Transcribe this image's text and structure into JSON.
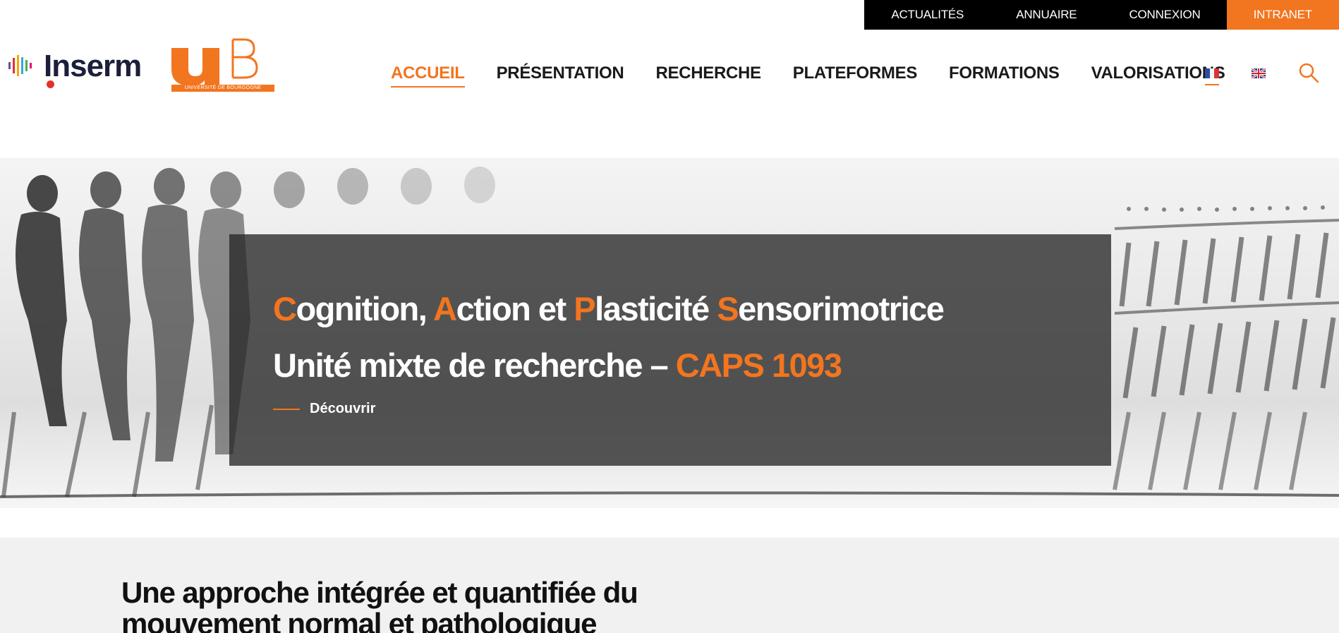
{
  "topbar": {
    "links": [
      "ACTUALITÉS",
      "ANNUAIRE",
      "CONNEXION",
      "INTRANET"
    ],
    "colors": {
      "default_bg": "#000000",
      "highlight_bg": "#f2751f"
    }
  },
  "logos": {
    "inserm": "Inserm",
    "ub_caption": "UNIVERSITÉ DE BOURGOGNE"
  },
  "nav": {
    "items": [
      "ACCUEIL",
      "PRÉSENTATION",
      "RECHERCHE",
      "PLATEFORMES",
      "FORMATIONS",
      "VALORISATIONS"
    ],
    "active": "ACCUEIL",
    "languages": [
      "fr",
      "en"
    ],
    "search_icon": "search-icon"
  },
  "hero": {
    "title": {
      "c": "C",
      "ognition": "ognition, ",
      "a": "A",
      "ction": "ction et ",
      "p": "P",
      "lasticite": "lasticité ",
      "s": "S",
      "ensorimotrice": "ensorimotrice"
    },
    "subtitle": {
      "text": "Unité mixte de recherche – ",
      "code": "CAPS 1093"
    },
    "cta": "Découvrir"
  },
  "section": {
    "heading": "Une approche intégrée et quantifiée du mouvement normal et pathologique"
  },
  "colors": {
    "accent": "#f2751f",
    "text": "#111111",
    "section_bg": "#f1f1f1"
  }
}
